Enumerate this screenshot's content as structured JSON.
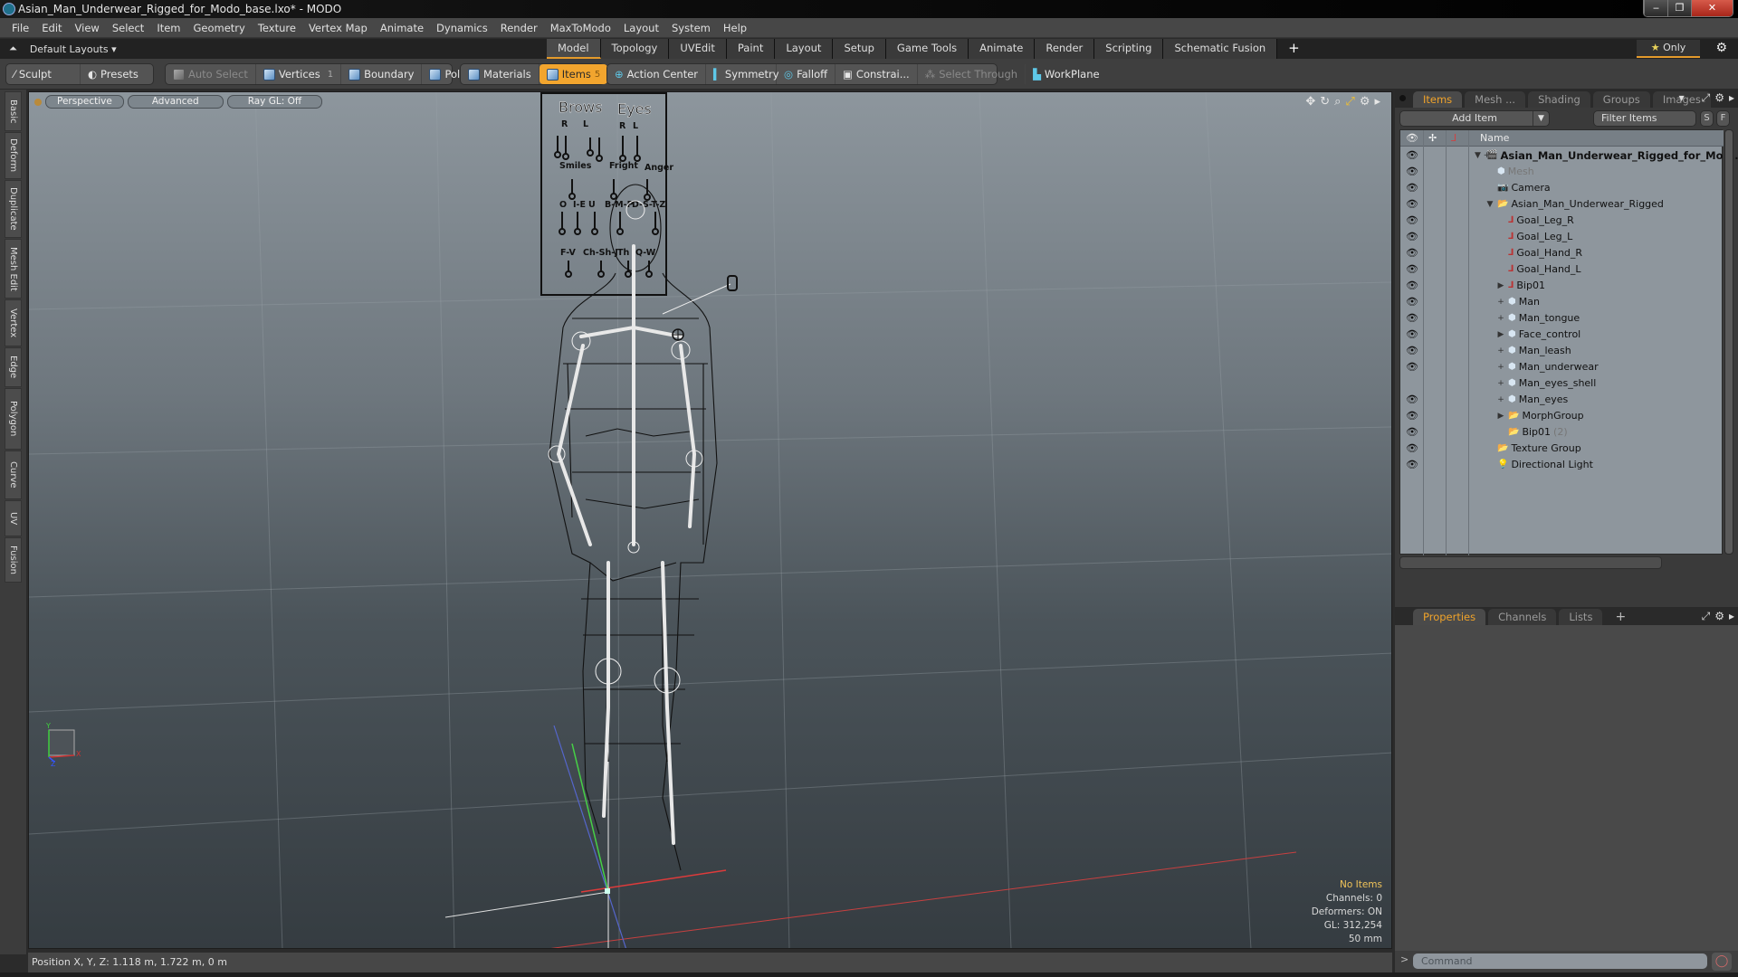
{
  "window": {
    "title": "Asian_Man_Underwear_Rigged_for_Modo_base.lxo* - MODO",
    "minimize": "‒",
    "restore": "❐",
    "close": "✕"
  },
  "menu": [
    "File",
    "Edit",
    "View",
    "Select",
    "Item",
    "Geometry",
    "Texture",
    "Vertex Map",
    "Animate",
    "Dynamics",
    "Render",
    "MaxToModo",
    "Layout",
    "System",
    "Help"
  ],
  "layouts": {
    "selector": "Default Layouts ▾",
    "tabs": [
      "Model",
      "Topology",
      "UVEdit",
      "Paint",
      "Layout",
      "Setup",
      "Game Tools",
      "Animate",
      "Render",
      "Scripting",
      "Schematic Fusion"
    ],
    "active_tab": "Model",
    "add": "+",
    "only": "Only"
  },
  "toolbar": {
    "sculpt": "Sculpt",
    "presets": "Presets",
    "auto_select": "Auto Select",
    "vertices": "Vertices",
    "vertices_count": "1",
    "boundary": "Boundary",
    "polygons": "Polygons",
    "materials": "Materials",
    "items": "Items",
    "items_count": "5",
    "action_center": "Action Center",
    "symmetry": "Symmetry",
    "falloff": "Falloff",
    "constraints": "Constrai...",
    "select_through": "Select Through",
    "workplane": "WorkPlane"
  },
  "left_tabs": [
    "Basic",
    "Deform",
    "Duplicate",
    "Mesh Edit",
    "Vertex",
    "Edge",
    "Polygon",
    "Curve",
    "UV",
    "Fusion"
  ],
  "viewport": {
    "view": "Perspective",
    "shading": "Advanced",
    "raygl": "Ray GL: Off",
    "icons": [
      "move-view-icon",
      "rotate-view-icon",
      "zoom-view-icon",
      "fit-view-icon",
      "viewport-gear-icon",
      "viewport-menu-icon"
    ],
    "face_rig_labels": {
      "brows": "Brows",
      "eyes": "Eyes",
      "r": "R",
      "l": "L",
      "row2": [
        "Smiles",
        "Fright",
        "Anger"
      ],
      "row3": [
        "O",
        "I-E",
        "U",
        "B-M-P",
        "D-S-T-Z"
      ],
      "row4": [
        "F-V",
        "Ch-Sh-J",
        "Th",
        "Q-W"
      ]
    },
    "hud": {
      "selection": "No Items",
      "channels": "Channels: 0",
      "deformers": "Deformers: ON",
      "gl": "GL: 312,254",
      "focal": "50 mm"
    },
    "axis": {
      "y": "Y",
      "x": "X",
      "z": "Z"
    }
  },
  "status": {
    "position": "Position X, Y, Z:   1.118 m, 1.722 m, 0 m"
  },
  "panel": {
    "tabs": [
      "Items",
      "Mesh ...",
      "Shading",
      "Groups",
      "Images"
    ],
    "active_tab": "Items",
    "add_item": "Add Item",
    "filter_placeholder": "Filter Items",
    "s": "S",
    "f": "F",
    "name_header": "Name",
    "items": [
      {
        "label": "Asian_Man_Underwear_Rigged_for_Mo ...",
        "depth": 0,
        "icon": "scene",
        "expander": "▼ +",
        "bold": true,
        "visible": true
      },
      {
        "label": "Mesh",
        "depth": 1,
        "icon": "mesh",
        "expander": "",
        "dim": true,
        "visible": true
      },
      {
        "label": "Camera",
        "depth": 1,
        "icon": "camera",
        "expander": "",
        "visible": true
      },
      {
        "label": "Asian_Man_Underwear_Rigged",
        "depth": 1,
        "icon": "group",
        "expander": "▼",
        "visible": true
      },
      {
        "label": "Goal_Leg_R",
        "depth": 2,
        "icon": "locator",
        "expander": "",
        "visible": true
      },
      {
        "label": "Goal_Leg_L",
        "depth": 2,
        "icon": "locator",
        "expander": "",
        "visible": true
      },
      {
        "label": "Goal_Hand_R",
        "depth": 2,
        "icon": "locator",
        "expander": "",
        "visible": true
      },
      {
        "label": "Goal_Hand_L",
        "depth": 2,
        "icon": "locator",
        "expander": "",
        "visible": true
      },
      {
        "label": "Bip01",
        "depth": 2,
        "icon": "locator",
        "expander": "▶",
        "visible": true
      },
      {
        "label": "Man",
        "depth": 2,
        "icon": "mesh",
        "expander": "+",
        "visible": true
      },
      {
        "label": "Man_tongue",
        "depth": 2,
        "icon": "mesh",
        "expander": "+",
        "visible": true
      },
      {
        "label": "Face_control",
        "depth": 2,
        "icon": "mesh",
        "expander": "▶",
        "visible": true
      },
      {
        "label": "Man_leash",
        "depth": 2,
        "icon": "mesh",
        "expander": "+",
        "visible": true
      },
      {
        "label": "Man_underwear",
        "depth": 2,
        "icon": "mesh",
        "expander": "+",
        "visible": true
      },
      {
        "label": "Man_eyes_shell",
        "depth": 2,
        "icon": "mesh",
        "expander": "+",
        "visible": false
      },
      {
        "label": "Man_eyes",
        "depth": 2,
        "icon": "mesh",
        "expander": "+",
        "visible": true
      },
      {
        "label": "MorphGroup",
        "depth": 2,
        "icon": "group",
        "expander": "▶",
        "visible": true
      },
      {
        "label": "Bip01",
        "suffix": "(2)",
        "depth": 2,
        "icon": "group",
        "expander": "",
        "visible": true
      },
      {
        "label": "Texture Group",
        "depth": 1,
        "icon": "group",
        "expander": "",
        "visible": true
      },
      {
        "label": "Directional Light",
        "depth": 1,
        "icon": "light",
        "expander": "",
        "visible": true
      }
    ],
    "bottom_tabs": [
      "Properties",
      "Channels",
      "Lists"
    ],
    "bottom_active": "Properties",
    "bottom_add": "+",
    "command_placeholder": "Command",
    "prompt": ">"
  }
}
